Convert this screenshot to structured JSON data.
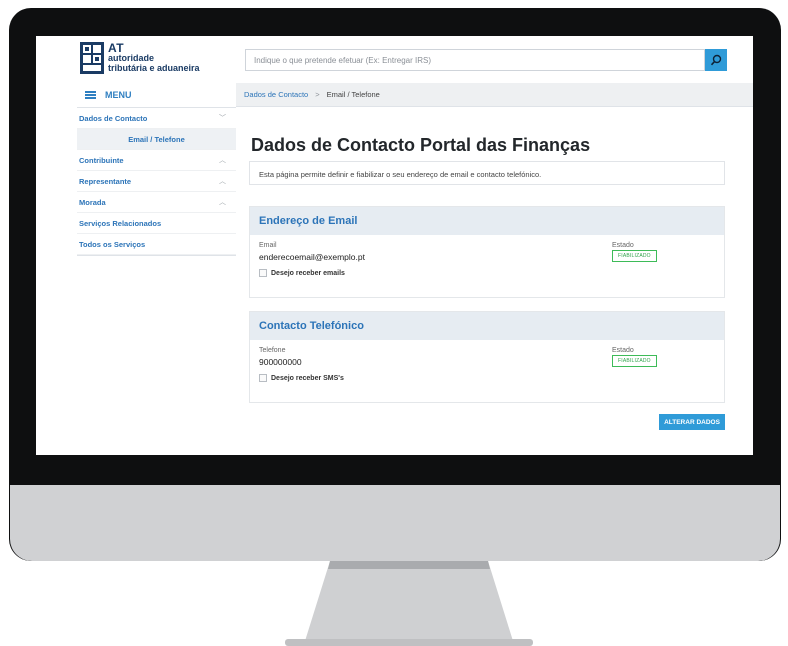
{
  "logo": {
    "acronym": "AT",
    "line1": "autoridade",
    "line2": "tributária e aduaneira"
  },
  "search": {
    "placeholder": "Indique o que pretende efetuar (Ex: Entregar IRS)"
  },
  "sidebar": {
    "menu_label": "MENU",
    "items": [
      {
        "label": "Dados de Contacto",
        "chevron": "chevron-down"
      },
      {
        "label": "Email / Telefone",
        "chevron": ""
      },
      {
        "label": "Contribuinte",
        "chevron": "chevron-up"
      },
      {
        "label": "Representante",
        "chevron": "chevron-up"
      },
      {
        "label": "Morada",
        "chevron": "chevron-up"
      },
      {
        "label": "Serviços Relacionados",
        "chevron": ""
      },
      {
        "label": "Todos os Serviços",
        "chevron": ""
      }
    ]
  },
  "breadcrumb": {
    "parent": "Dados de Contacto",
    "separator": ">",
    "current": "Email / Telefone"
  },
  "page": {
    "title": "Dados de Contacto Portal das Finanças",
    "description": "Esta página permite definir e fiabilizar o seu endereço de email e contacto telefónico."
  },
  "email_card": {
    "title": "Endereço de Email",
    "field_label": "Email",
    "field_value": "enderecoemail@exemplo.pt",
    "status_label": "Estado",
    "status_value": "FIABILIZADO",
    "checkbox_label": "Desejo receber emails"
  },
  "phone_card": {
    "title": "Contacto Telefónico",
    "field_label": "Telefone",
    "field_value": "900000000",
    "status_label": "Estado",
    "status_value": "FIABILIZADO",
    "checkbox_label": "Desejo receber SMS's"
  },
  "actions": {
    "alterar_label": "ALTERAR DADOS"
  },
  "colors": {
    "accent": "#2f9bd8",
    "link": "#2c74b8",
    "status_green": "#3dbb58",
    "card_header": "#e6ecf2"
  }
}
